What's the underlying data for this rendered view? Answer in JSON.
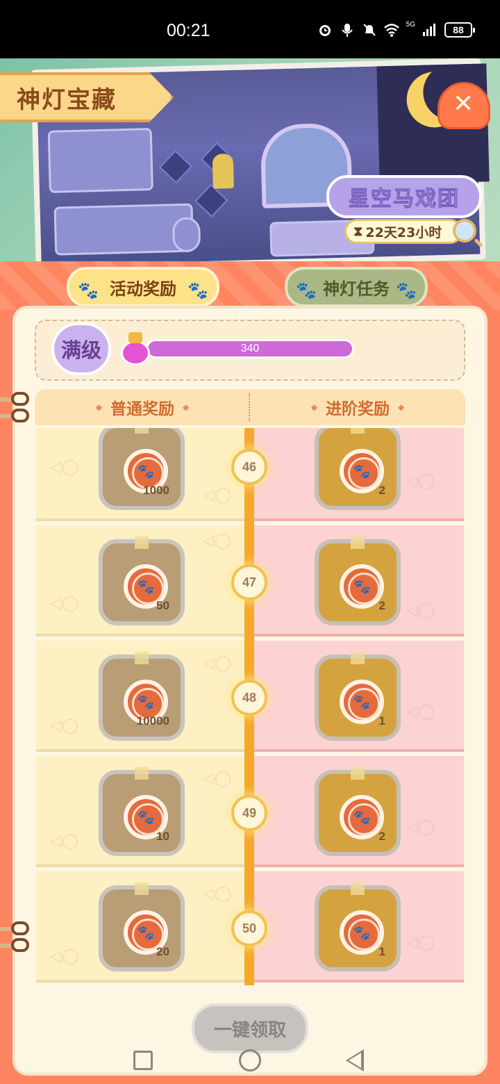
{
  "status_bar": {
    "time": "00:21",
    "network": "5G",
    "battery": "88",
    "icons": [
      "alarm-icon",
      "mic-icon",
      "mute-icon",
      "wifi-icon",
      "signal-icon",
      "battery-icon"
    ]
  },
  "banner": {
    "title": "神灯宝藏",
    "event_name": "星空马戏团",
    "countdown": "22天23小时",
    "close_icon": "close-icon"
  },
  "tabs": [
    {
      "label": "活动奖励",
      "active": true
    },
    {
      "label": "神灯任务",
      "active": false
    }
  ],
  "level": {
    "badge": "满级",
    "progress_value": "340",
    "progress_fraction": 1.0
  },
  "columns": {
    "normal": "普通奖励",
    "advanced": "进阶奖励"
  },
  "reward_rows": [
    {
      "level": "46",
      "normal_qty": "1000",
      "advanced_qty": "2"
    },
    {
      "level": "47",
      "normal_qty": "50",
      "advanced_qty": "2"
    },
    {
      "level": "48",
      "normal_qty": "10000",
      "advanced_qty": "1"
    },
    {
      "level": "49",
      "normal_qty": "10",
      "advanced_qty": "2"
    },
    {
      "level": "50",
      "normal_qty": "20",
      "advanced_qty": "1"
    }
  ],
  "claim_button": "一键领取",
  "colors": {
    "panel": "#ff8560",
    "tab_active": "#fde28a",
    "tab_inactive": "#a9b884",
    "progress": "#cc6ad8",
    "spine": "#f6a82b"
  }
}
